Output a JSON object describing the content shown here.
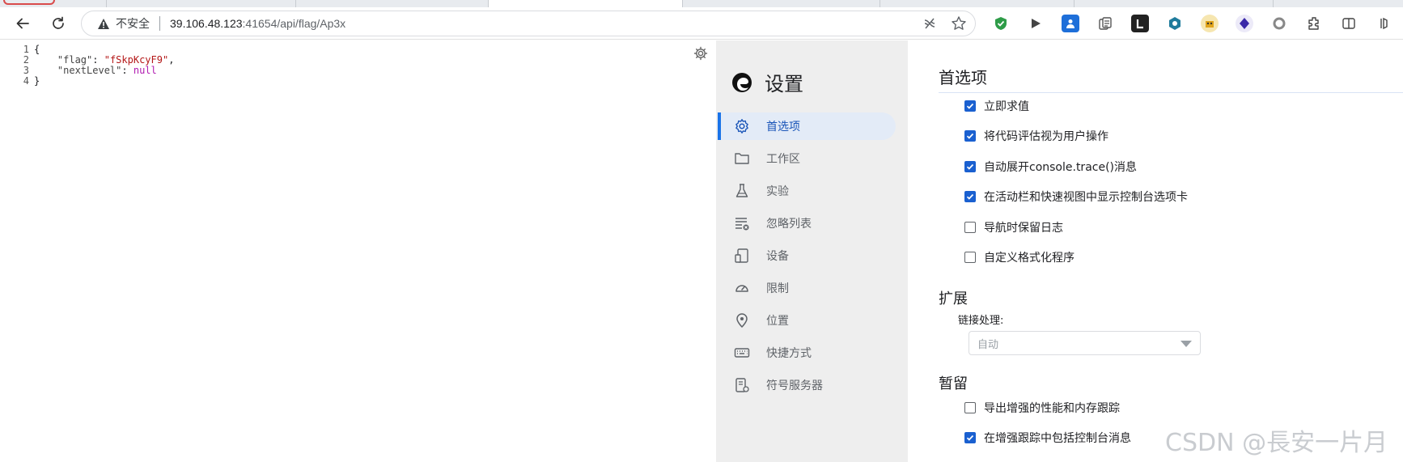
{
  "browser": {
    "security_label": "不安全",
    "url_host": "39.106.48.123",
    "url_path": ":41654/api/flag/Ap3x"
  },
  "json_view": {
    "lines": [
      {
        "num": "1",
        "text": "{"
      },
      {
        "num": "2",
        "key": "\"flag\"",
        "value": "\"fSkpKcyF9\"",
        "trail": ","
      },
      {
        "num": "3",
        "key": "\"nextLevel\"",
        "value": "null",
        "trail": ""
      },
      {
        "num": "4",
        "text": "}"
      }
    ]
  },
  "settings": {
    "title": "设置",
    "nav": [
      {
        "label": "首选项",
        "icon": "gear-icon",
        "active": true
      },
      {
        "label": "工作区",
        "icon": "folder-icon",
        "active": false
      },
      {
        "label": "实验",
        "icon": "flask-icon",
        "active": false
      },
      {
        "label": "忽略列表",
        "icon": "ignore-list-icon",
        "active": false
      },
      {
        "label": "设备",
        "icon": "devices-icon",
        "active": false
      },
      {
        "label": "限制",
        "icon": "throttle-icon",
        "active": false
      },
      {
        "label": "位置",
        "icon": "location-pin-icon",
        "active": false
      },
      {
        "label": "快捷方式",
        "icon": "keyboard-icon",
        "active": false
      },
      {
        "label": "符号服务器",
        "icon": "symbol-server-icon",
        "active": false
      }
    ],
    "main_heading": "首选项",
    "checkboxes_top": [
      {
        "label": "立即求值",
        "checked": true
      },
      {
        "label": "将代码评估视为用户操作",
        "checked": true
      },
      {
        "label": "自动展开console.trace()消息",
        "checked": true
      },
      {
        "label": "在活动栏和快速视图中显示控制台选项卡",
        "checked": true
      },
      {
        "label": "导航时保留日志",
        "checked": false
      },
      {
        "label": "自定义格式化程序",
        "checked": false
      }
    ],
    "extensions_heading": "扩展",
    "link_handling_label": "链接处理:",
    "link_handling_value": "自动",
    "persistence_heading": "暂留",
    "checkboxes_bottom": [
      {
        "label": "导出增强的性能和内存跟踪",
        "checked": false
      },
      {
        "label": "在增强跟踪中包括控制台消息",
        "checked": true
      }
    ]
  },
  "watermark": "CSDN @長安一片月",
  "colors": {
    "accent": "#1a73e8",
    "checkbox_on": "#1a60d0",
    "json_string": "#b41818",
    "json_null": "#b11cb1"
  }
}
